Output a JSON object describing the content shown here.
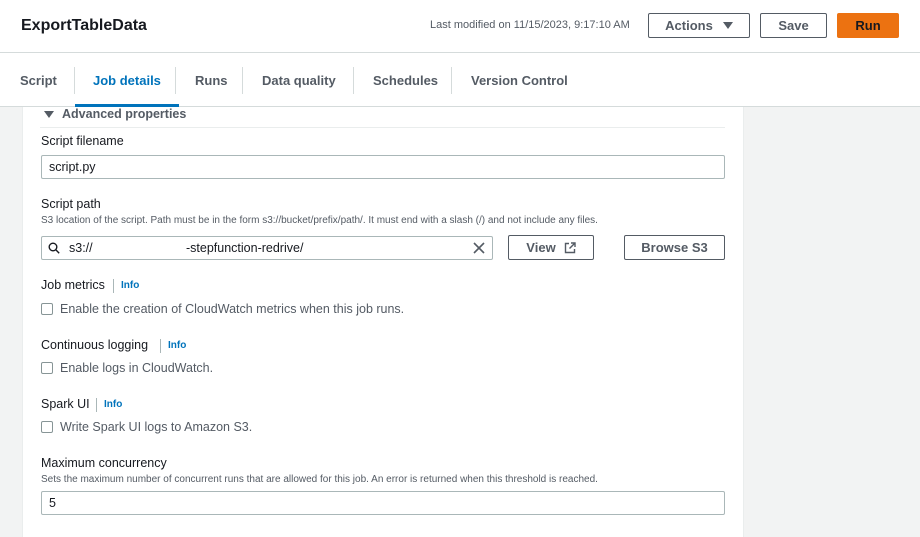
{
  "header": {
    "title": "ExportTableData",
    "last_modified": "Last modified on 11/15/2023, 9:17:10 AM",
    "actions_label": "Actions",
    "save_label": "Save",
    "run_label": "Run"
  },
  "tabs": [
    {
      "label": "Script",
      "active": false
    },
    {
      "label": "Job details",
      "active": true
    },
    {
      "label": "Runs",
      "active": false
    },
    {
      "label": "Data quality",
      "active": false
    },
    {
      "label": "Schedules",
      "active": false
    },
    {
      "label": "Version Control",
      "active": false
    }
  ],
  "advanced": {
    "heading": "Advanced properties",
    "script_filename": {
      "label": "Script filename",
      "value": "script.py"
    },
    "script_path": {
      "label": "Script path",
      "description": "S3 location of the script. Path must be in the form s3://bucket/prefix/path/. It must end with a slash (/) and not include any files.",
      "value_prefix": "s3://",
      "value_suffix": "-stepfunction-redrive/",
      "view_label": "View",
      "browse_label": "Browse S3"
    },
    "job_metrics": {
      "label": "Job metrics",
      "info": "Info",
      "checkbox_label": "Enable the creation of CloudWatch metrics when this job runs.",
      "checked": false
    },
    "continuous_logging": {
      "label": "Continuous logging",
      "info": "Info",
      "checkbox_label": "Enable logs in CloudWatch.",
      "checked": false
    },
    "spark_ui": {
      "label": "Spark UI",
      "info": "Info",
      "checkbox_label": "Write Spark UI logs to Amazon S3.",
      "checked": false
    },
    "max_concurrency": {
      "label": "Maximum concurrency",
      "description": "Sets the maximum number of concurrent runs that are allowed for this job. An error is returned when this threshold is reached.",
      "value": "5"
    }
  },
  "colors": {
    "accent": "#0073bb",
    "run_button": "#ec7211",
    "background": "#f2f3f3"
  }
}
